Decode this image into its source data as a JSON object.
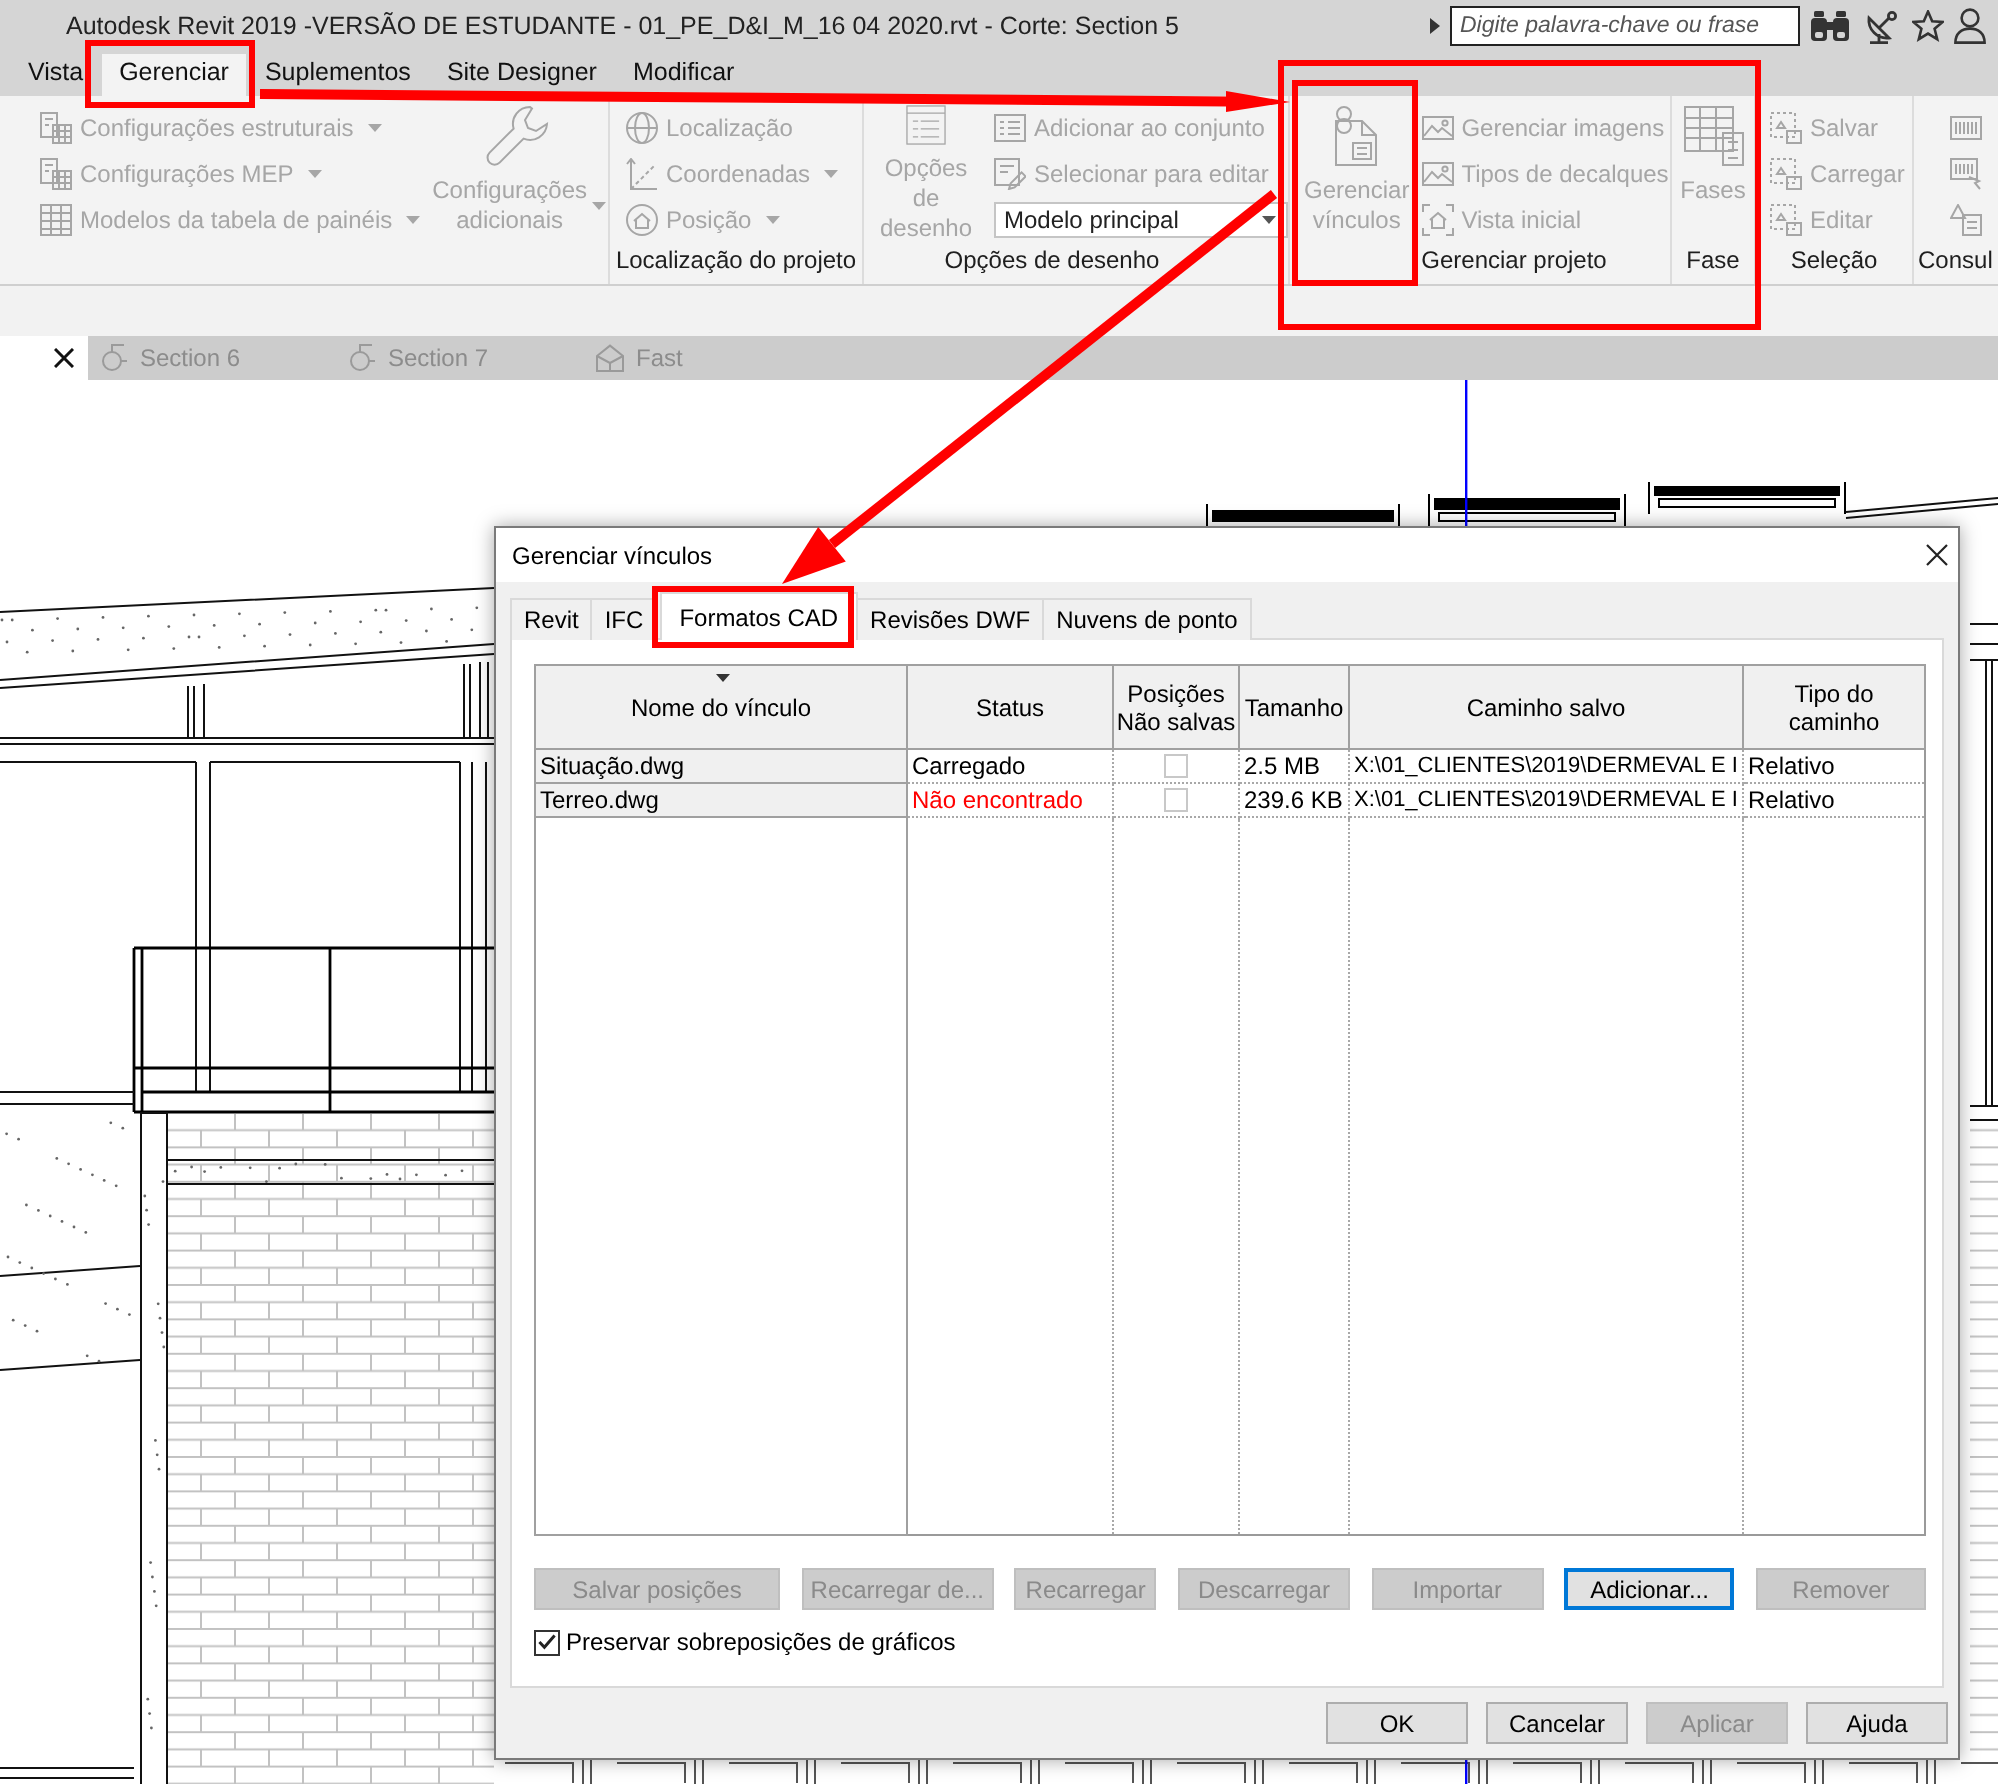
{
  "window": {
    "title": "Autodesk Revit 2019 -VERSÃO DE ESTUDANTE - 01_PE_D&I_M_16 04 2020.rvt - Corte: Section 5"
  },
  "search": {
    "placeholder": "Digite palavra-chave ou frase"
  },
  "ribbon_tabs": [
    {
      "label": "Vista",
      "selected": false
    },
    {
      "label": "Gerenciar",
      "selected": true
    },
    {
      "label": "Suplementos",
      "selected": false
    },
    {
      "label": "Site Designer",
      "selected": false
    },
    {
      "label": "Modificar",
      "selected": false
    }
  ],
  "ribbon_panels": [
    {
      "items": [
        {
          "kind": "small",
          "label": "Configurações estruturais",
          "dropdown": true,
          "disabled": true
        },
        {
          "kind": "small",
          "label": "Configurações MEP",
          "dropdown": true,
          "disabled": true
        },
        {
          "kind": "small",
          "label": "Modelos da tabela de painéis",
          "dropdown": true,
          "disabled": true
        },
        {
          "kind": "large",
          "label": "Configurações\nadicionais",
          "dropdown": true,
          "disabled": true
        }
      ]
    },
    {
      "title": "Localização do projeto",
      "items": [
        {
          "kind": "small",
          "label": "Localização",
          "dropdown": false,
          "disabled": true
        },
        {
          "kind": "small",
          "label": "Coordenadas",
          "dropdown": true,
          "disabled": true
        },
        {
          "kind": "small",
          "label": "Posição",
          "dropdown": true,
          "disabled": true
        }
      ]
    },
    {
      "title": "Opções de desenho",
      "items": [
        {
          "kind": "large",
          "label": "Opções de\ndesenho",
          "dropdown": false,
          "disabled": true
        },
        {
          "kind": "small",
          "label": "Adicionar ao conjunto",
          "dropdown": false,
          "disabled": true
        },
        {
          "kind": "small",
          "label": "Selecionar para editar",
          "dropdown": false,
          "disabled": true
        },
        {
          "kind": "combo",
          "value": "Modelo principal",
          "disabled": false
        }
      ]
    },
    {
      "title": "Gerenciar projeto",
      "items": [
        {
          "kind": "large",
          "label": "Gerenciar\nvínculos",
          "dropdown": false,
          "disabled": true
        },
        {
          "kind": "small",
          "label": "Gerenciar imagens",
          "dropdown": false,
          "disabled": true
        },
        {
          "kind": "small",
          "label": "Tipos de decalques",
          "dropdown": false,
          "disabled": true
        },
        {
          "kind": "small",
          "label": "Vista inicial",
          "dropdown": false,
          "disabled": true
        }
      ]
    },
    {
      "title": "Fase",
      "items": [
        {
          "kind": "large",
          "label": "Fases",
          "dropdown": false,
          "disabled": true
        }
      ]
    },
    {
      "title": "Seleção",
      "items": [
        {
          "kind": "small",
          "label": "Salvar",
          "dropdown": false,
          "disabled": true
        },
        {
          "kind": "small",
          "label": "Carregar",
          "dropdown": false,
          "disabled": true
        },
        {
          "kind": "small",
          "label": "Editar",
          "dropdown": false,
          "disabled": true
        }
      ]
    },
    {
      "title": "Consul",
      "items": [
        {
          "kind": "icon",
          "disabled": true
        },
        {
          "kind": "icon",
          "disabled": true
        },
        {
          "kind": "icon",
          "disabled": true
        }
      ]
    }
  ],
  "view_tabs": [
    {
      "selected": true
    },
    {
      "kind": "section",
      "label": "Section 6",
      "selected": false
    },
    {
      "kind": "section",
      "label": "Section 7",
      "selected": false
    },
    {
      "kind": "perspective",
      "label": "Fast",
      "selected": false
    }
  ],
  "dialog": {
    "title": "Gerenciar vínculos",
    "tabs": [
      {
        "label": "Revit",
        "selected": false
      },
      {
        "label": "IFC",
        "selected": false
      },
      {
        "label": "Formatos CAD",
        "selected": true
      },
      {
        "label": "Revisões DWF",
        "selected": false
      },
      {
        "label": "Nuvens de ponto",
        "selected": false
      }
    ],
    "table": {
      "columns": [
        {
          "label": "Nome do vínculo",
          "sorted": true
        },
        {
          "label": "Status",
          "sorted": false
        },
        {
          "label": "Posições\nNão salvas",
          "sorted": false
        },
        {
          "label": "Tamanho",
          "sorted": false
        },
        {
          "label": "Caminho salvo",
          "sorted": false
        },
        {
          "label": "Tipo do\ncaminho",
          "sorted": false
        }
      ],
      "rows": [
        {
          "name": "Situação.dwg",
          "status": "Carregado",
          "found": true,
          "positions_unsaved": false,
          "size": "2.5 MB",
          "saved_path": "X:\\01_CLIENTES\\2019\\DERMEVAL E I",
          "path_type": "Relativo"
        },
        {
          "name": "Terreo.dwg",
          "status": "Não encontrado",
          "found": false,
          "positions_unsaved": false,
          "size": "239.6 KB",
          "saved_path": "X:\\01_CLIENTES\\2019\\DERMEVAL E I",
          "path_type": "Relativo"
        }
      ]
    },
    "actions": [
      {
        "label": "Salvar posições",
        "disabled": true,
        "focused": false
      },
      {
        "label": "Recarregar de...",
        "disabled": true,
        "focused": false
      },
      {
        "label": "Recarregar",
        "disabled": true,
        "focused": false
      },
      {
        "label": "Descarregar",
        "disabled": true,
        "focused": false
      },
      {
        "label": "Importar",
        "disabled": true,
        "focused": false
      },
      {
        "label": "Adicionar...",
        "disabled": false,
        "focused": true
      },
      {
        "label": "Remover",
        "disabled": true,
        "focused": false
      }
    ],
    "preserve_overrides": {
      "label": "Preservar sobreposições de gráficos",
      "checked": true
    },
    "buttons": [
      {
        "label": "OK",
        "disabled": false
      },
      {
        "label": "Cancelar",
        "disabled": false
      },
      {
        "label": "Aplicar",
        "disabled": true
      },
      {
        "label": "Ajuda",
        "disabled": false
      }
    ]
  }
}
